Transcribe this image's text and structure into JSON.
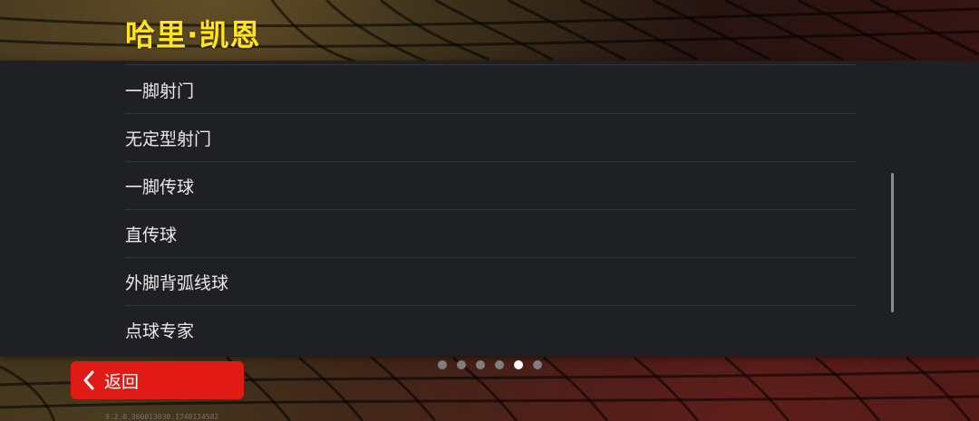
{
  "header": {
    "title": "哈里·凯恩"
  },
  "list": {
    "items": [
      {
        "label": "一脚射门"
      },
      {
        "label": "无定型射门"
      },
      {
        "label": "一脚传球"
      },
      {
        "label": "直传球"
      },
      {
        "label": "外脚背弧线球"
      },
      {
        "label": "点球专家"
      }
    ]
  },
  "pagination": {
    "total": 6,
    "active_index": 4
  },
  "back_button": {
    "label": "返回",
    "icon": "chevron-left-icon"
  },
  "footer": {
    "version": "9.2.0.360013030.1740134582"
  },
  "colors": {
    "title": "#ffe51a",
    "panel": "#1f2024",
    "back_button": "#e01a14"
  }
}
